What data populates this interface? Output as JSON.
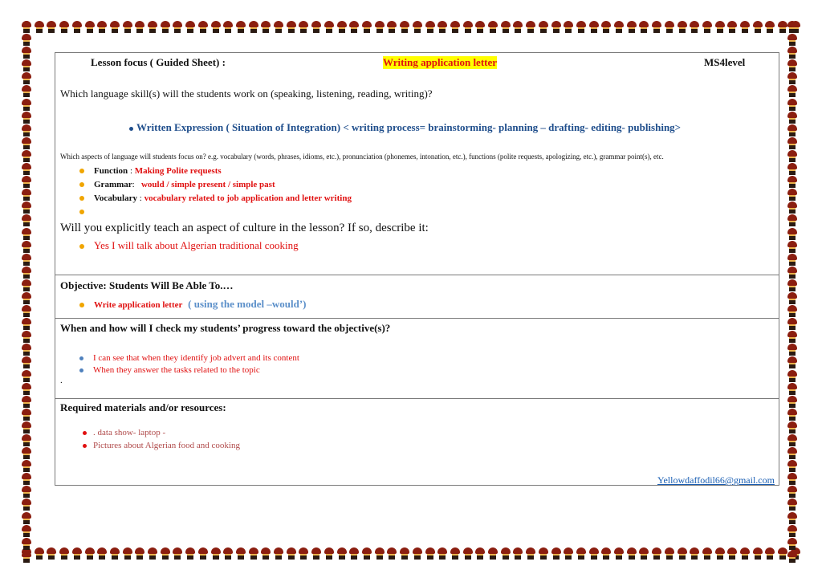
{
  "header": {
    "focus_label": "Lesson focus ( Guided Sheet)  :",
    "topic": "Writing application letter",
    "level": "MS4level"
  },
  "skills": {
    "question": "Which language skill(s) will the students work on (speaking, listening, reading, writing)?",
    "answer": "Written Expression ( Situation of Integration) < writing process= brainstorming- planning – drafting- editing- publishing>"
  },
  "aspects": {
    "question": "Which aspects of language will students focus on?  e.g. vocabulary (words, phrases, idioms, etc.),  pronunciation (phonemes, intonation, etc.), functions (polite requests, apologizing, etc.), grammar point(s), etc.",
    "items": [
      {
        "label": "Function",
        "sep": " : ",
        "value": "Making Polite requests"
      },
      {
        "label": "Grammar",
        "sep": ":   ",
        "value": "would / simple present / simple past"
      },
      {
        "label": "Vocabulary",
        "sep": " : ",
        "value": "vocabulary related to job application and letter writing"
      }
    ]
  },
  "culture": {
    "question": "Will you explicitly teach an aspect of culture in the lesson? If so, describe it:",
    "answer": "Yes I will talk about Algerian traditional cooking"
  },
  "objective": {
    "title": "Objective:  Students Will Be Able To.…",
    "item_main": "Write application letter",
    "item_extra": "( using the model –would’)"
  },
  "check": {
    "title": "When and how will I check my students’ progress toward the objective(s)?",
    "items": [
      "I can see that when they identify job advert and its content",
      "When they answer the tasks related to the topic"
    ],
    "trailing": "."
  },
  "materials": {
    "title": "Required materials and/or resources:",
    "items": [
      ". data show- laptop -",
      "Pictures about Algerian food and cooking"
    ]
  },
  "footer": {
    "email": "Yellowdaffodil66@gmail.com"
  }
}
